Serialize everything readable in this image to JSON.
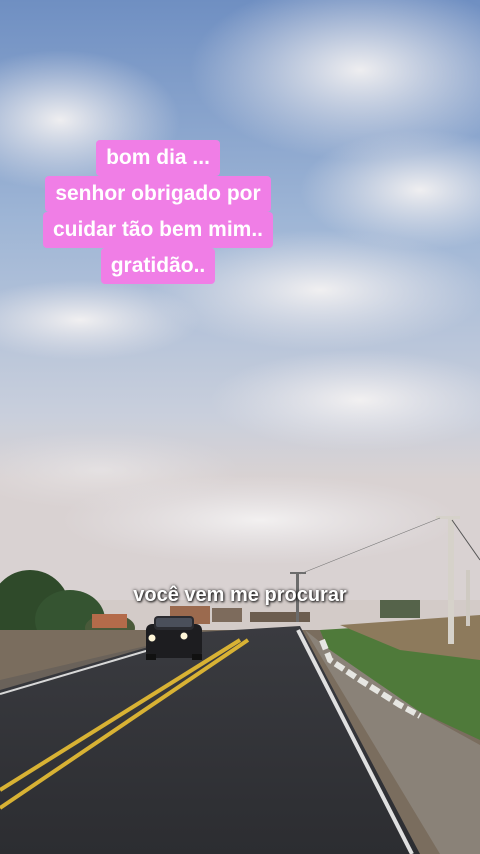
{
  "caption": {
    "lines": [
      "bom dia ...",
      "senhor obrigado por",
      "cuidar tão bem mim..",
      "gratidão.."
    ],
    "background_color": "#f07ee6",
    "text_color": "#ffffff"
  },
  "lyric": {
    "text": "você vem me procurar"
  }
}
